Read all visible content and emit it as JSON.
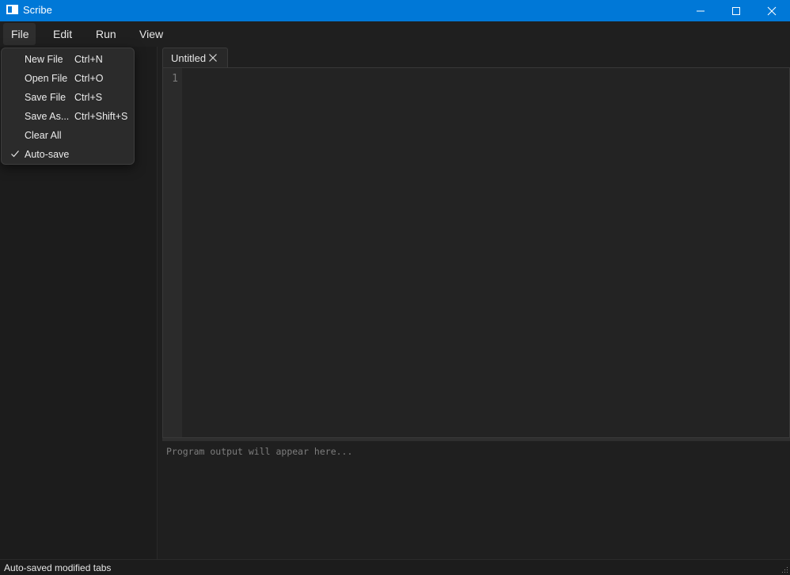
{
  "window": {
    "title": "Scribe"
  },
  "menubar": {
    "items": [
      "File",
      "Edit",
      "Run",
      "View"
    ]
  },
  "file_menu": {
    "items": [
      {
        "label": "New File",
        "shortcut": "Ctrl+N"
      },
      {
        "label": "Open File",
        "shortcut": "Ctrl+O"
      },
      {
        "label": "Save File",
        "shortcut": "Ctrl+S"
      },
      {
        "label": "Save As...",
        "shortcut": "Ctrl+Shift+S"
      },
      {
        "label": "Clear All",
        "shortcut": ""
      },
      {
        "label": "Auto-save",
        "shortcut": "",
        "checked": true
      }
    ]
  },
  "tabs": [
    {
      "label": "Untitled"
    }
  ],
  "editor": {
    "line_numbers": [
      "1"
    ]
  },
  "output": {
    "placeholder": "Program output will appear here..."
  },
  "status": {
    "text": "Auto-saved modified tabs"
  },
  "colors": {
    "accent": "#0078d7",
    "background": "#1f1f1f",
    "menu_background": "#2b2b2b"
  }
}
